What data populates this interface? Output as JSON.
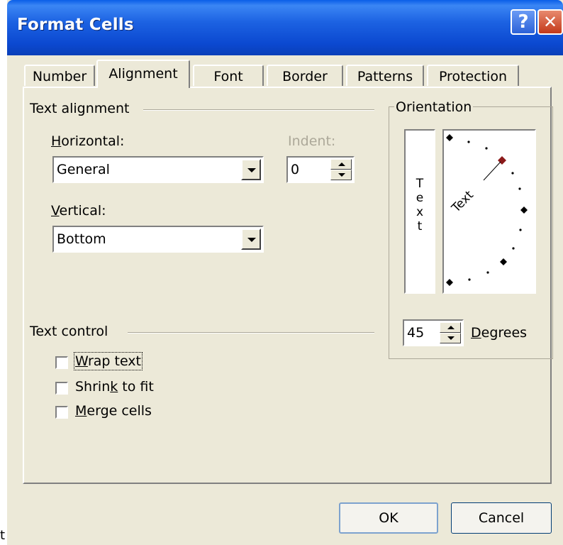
{
  "window": {
    "title": "Format Cells",
    "help_glyph": "?",
    "close_glyph": "✕",
    "colors": {
      "titlebar": "#0b4fd8",
      "face": "#ece9d8"
    }
  },
  "tabs": [
    {
      "label": "Number"
    },
    {
      "label": "Alignment",
      "selected": true
    },
    {
      "label": "Font"
    },
    {
      "label": "Border"
    },
    {
      "label": "Patterns"
    },
    {
      "label": "Protection"
    }
  ],
  "text_alignment": {
    "group_label": "Text alignment",
    "horizontal": {
      "label_key": "H",
      "label_rest": "orizontal:",
      "value": "General"
    },
    "vertical": {
      "label_key": "V",
      "label_rest": "ertical:",
      "value": "Bottom"
    },
    "indent": {
      "label": "Indent:",
      "value": "0"
    }
  },
  "orientation": {
    "group_label": "Orientation",
    "vertical_text": [
      "T",
      "e",
      "x",
      "t"
    ],
    "dial_text": "Text",
    "degrees": {
      "value": "45",
      "label_key": "D",
      "label_rest": "egrees"
    }
  },
  "text_control": {
    "group_label": "Text control",
    "wrap": {
      "key": "W",
      "rest": "rap text",
      "checked": false
    },
    "shrink": {
      "pre": "Shrin",
      "key": "k",
      "rest": " to fit",
      "checked": false
    },
    "merge": {
      "key": "M",
      "rest": "erge cells",
      "checked": false
    }
  },
  "buttons": {
    "ok": "OK",
    "cancel": "Cancel"
  },
  "stray_text": "t"
}
